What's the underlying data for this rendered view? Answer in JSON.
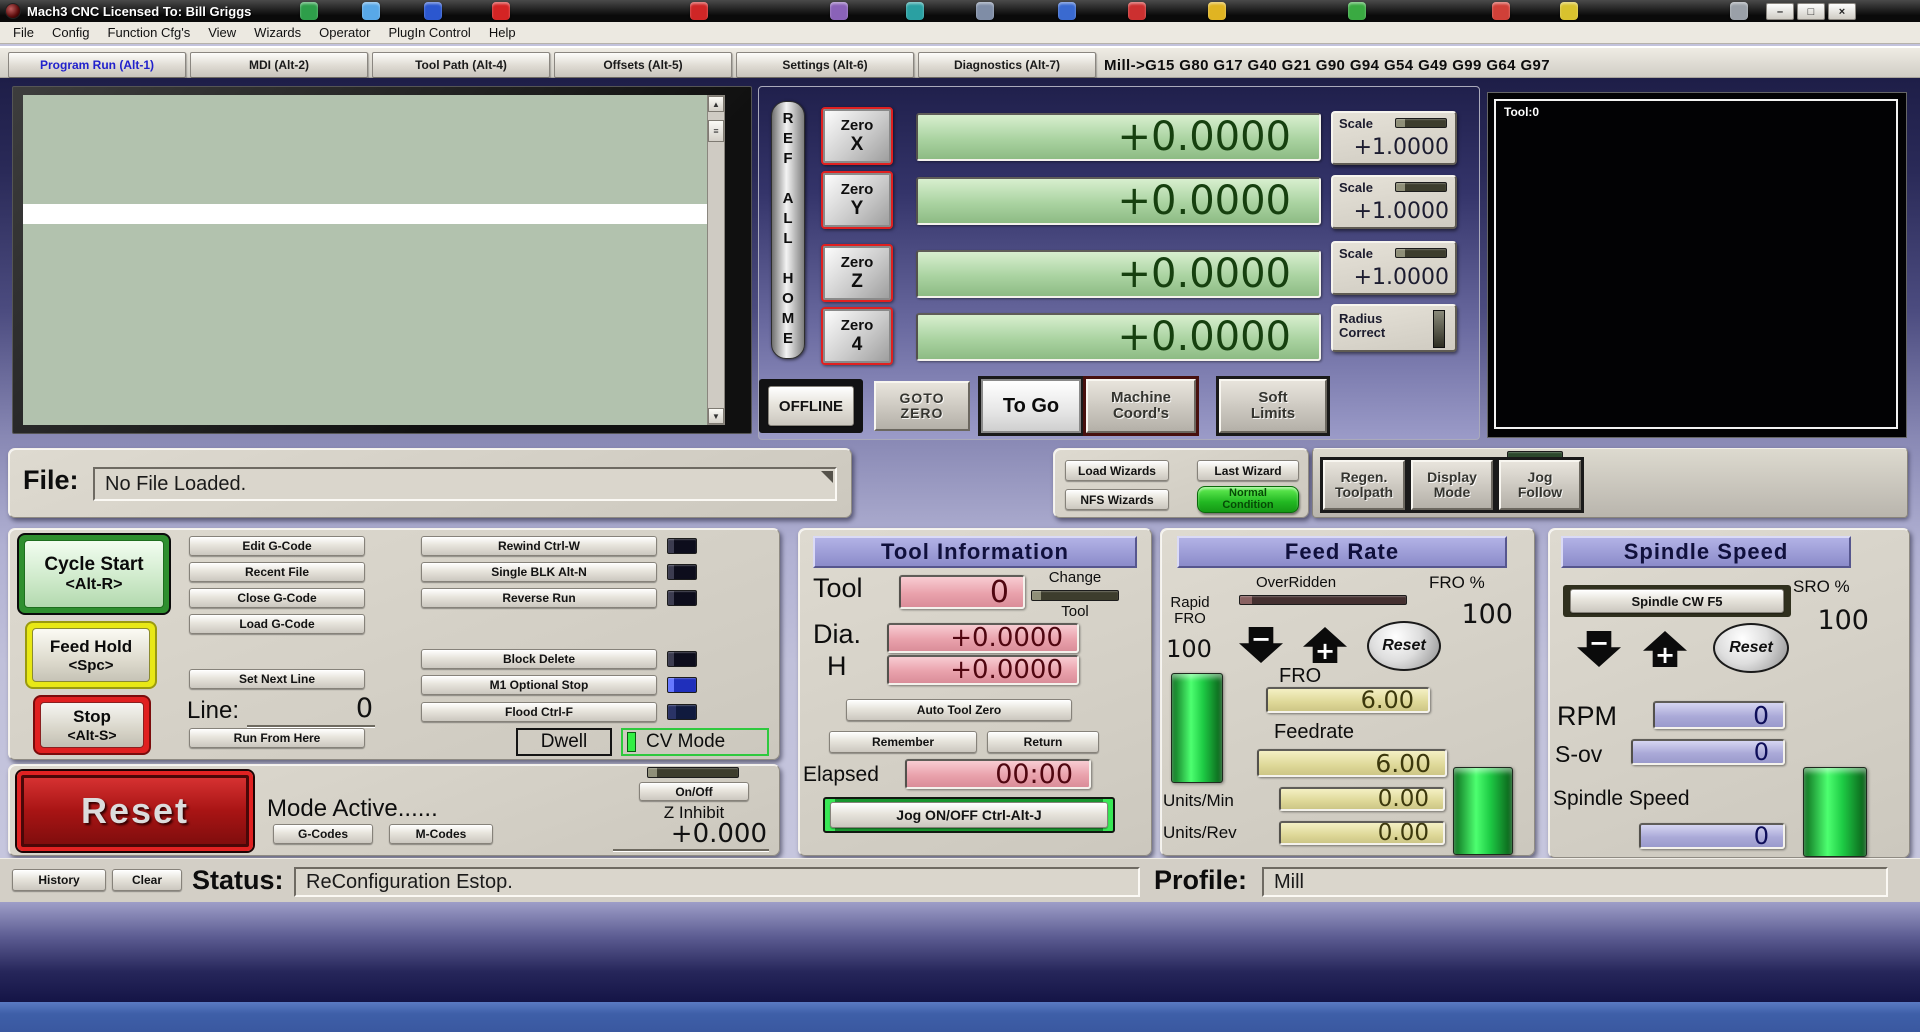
{
  "titlebar": {
    "title": "Mach3 CNC  Licensed To: Bill Griggs",
    "minimize": "–",
    "maximize": "□",
    "close": "×"
  },
  "menubar": {
    "items": [
      "File",
      "Config",
      "Function Cfg's",
      "View",
      "Wizards",
      "Operator",
      "PlugIn Control",
      "Help"
    ]
  },
  "tabs": {
    "items": [
      "Program Run (Alt-1)",
      "MDI (Alt-2)",
      "Tool Path (Alt-4)",
      "Offsets (Alt-5)",
      "Settings (Alt-6)",
      "Diagnostics (Alt-7)"
    ],
    "gcode_modes": "Mill->G15  G80 G17 G40 G21 G90 G94 G54 G49 G99 G64 G97"
  },
  "dro": {
    "ref_all_home": "REF ALL HOME",
    "axes": [
      {
        "button": "Zero",
        "axis": "X",
        "value": "+0.0000"
      },
      {
        "button": "Zero",
        "axis": "Y",
        "value": "+0.0000"
      },
      {
        "button": "Zero",
        "axis": "Z",
        "value": "+0.0000"
      },
      {
        "button": "Zero",
        "axis": "4",
        "value": "+0.0000"
      }
    ],
    "scale_label": "Scale",
    "scales": [
      "+1.0000",
      "+1.0000",
      "+1.0000"
    ],
    "radius_correct": "Radius\nCorrect",
    "offline": "OFFLINE",
    "goto_zero": "GOTO\nZERO",
    "to_go": "To Go",
    "machine_coords": "Machine\nCoord's",
    "soft_limits": "Soft\nLimits"
  },
  "toolpath": {
    "tool_label": "Tool:0"
  },
  "file_row": {
    "label": "File:",
    "value": "No File Loaded."
  },
  "wizards": {
    "load": "Load Wizards",
    "last": "Last Wizard",
    "nfs": "NFS Wizards",
    "condition": "Normal\nCondition"
  },
  "view_buttons": {
    "regen": "Regen.\nToolpath",
    "display": "Display\nMode",
    "jog": "Jog\nFollow"
  },
  "run_controls": {
    "cycle_start": "Cycle Start",
    "cycle_start_key": "<Alt-R>",
    "feed_hold": "Feed Hold",
    "feed_hold_key": "<Spc>",
    "stop": "Stop",
    "stop_key": "<Alt-S>",
    "reset": "Reset"
  },
  "gcode_file": {
    "edit": "Edit G-Code",
    "recent": "Recent File",
    "close": "Close G-Code",
    "load": "Load G-Code",
    "set_next_line": "Set Next Line",
    "line_label": "Line:",
    "line_value": "0",
    "run_from_here": "Run From Here"
  },
  "options": {
    "rewind": "Rewind Ctrl-W",
    "single_blk": "Single BLK Alt-N",
    "reverse_run": "Reverse Run",
    "block_delete": "Block Delete",
    "m1_optional": "M1 Optional Stop",
    "flood": "Flood Ctrl-F",
    "dwell": "Dwell",
    "cv_mode": "CV Mode"
  },
  "mode_row": {
    "mode_active": "Mode Active......",
    "g_codes": "G-Codes",
    "m_codes": "M-Codes",
    "on_off": "On/Off",
    "z_inhibit": "Z Inhibit",
    "z_value": "+0.000"
  },
  "tool_info": {
    "title": "Tool Information",
    "tool_label": "Tool",
    "tool_value": "0",
    "change": "Change",
    "change_sub": "Tool",
    "dia_label": "Dia.",
    "dia_value": "+0.0000",
    "h_label": "H",
    "h_value": "+0.0000",
    "auto_tool_zero": "Auto Tool Zero",
    "remember": "Remember",
    "return": "Return",
    "elapsed_label": "Elapsed",
    "elapsed_value": "00:00",
    "jog_onoff": "Jog ON/OFF Ctrl-Alt-J"
  },
  "feed_rate": {
    "title": "Feed Rate",
    "overridden": "OverRidden",
    "fro_pct_label": "FRO %",
    "fro_pct": "100",
    "rapid_label": "Rapid\nFRO",
    "rapid_value": "100",
    "minus": "−",
    "plus": "+",
    "reset": "Reset",
    "fro_label": "FRO",
    "fro_value": "6.00",
    "feedrate_label": "Feedrate",
    "feedrate_value": "6.00",
    "units_min_label": "Units/Min",
    "units_min": "0.00",
    "units_rev_label": "Units/Rev",
    "units_rev": "0.00"
  },
  "spindle": {
    "title": "Spindle Speed",
    "cw_button": "Spindle CW F5",
    "sro_pct_label": "SRO %",
    "sro_pct": "100",
    "minus": "−",
    "plus": "+",
    "reset": "Reset",
    "rpm_label": "RPM",
    "rpm_value": "0",
    "sov_label": "S-ov",
    "sov_value": "0",
    "speed_label": "Spindle Speed",
    "speed_value": "0"
  },
  "status_bar": {
    "history": "History",
    "clear": "Clear",
    "status_label": "Status:",
    "status_value": "ReConfiguration Estop.",
    "profile_label": "Profile:",
    "profile_value": "Mill"
  },
  "desktop_icons": {
    "colors": [
      "#2e9e4a",
      "#58a8e8",
      "#2b57cf",
      "#d42424",
      "#cf2626",
      "#8a62b8",
      "#2aa0a2",
      "#7f8da6",
      "#3a6ad0",
      "#cc3030",
      "#e0b422",
      "#3aaa42",
      "#d04038",
      "#d8c22e",
      "#9aa0a8"
    ]
  },
  "colors": {
    "dro_green": "#aad3a1",
    "dro_pink": "#e9a2ac",
    "dro_yellow": "#ded898",
    "dro_lavender": "#abaad8",
    "indicator_green": "#2ecc4e",
    "led_blue": "#2233cc",
    "estop_red": "#cc1616",
    "normal_condition_green": "#2fc52f"
  }
}
